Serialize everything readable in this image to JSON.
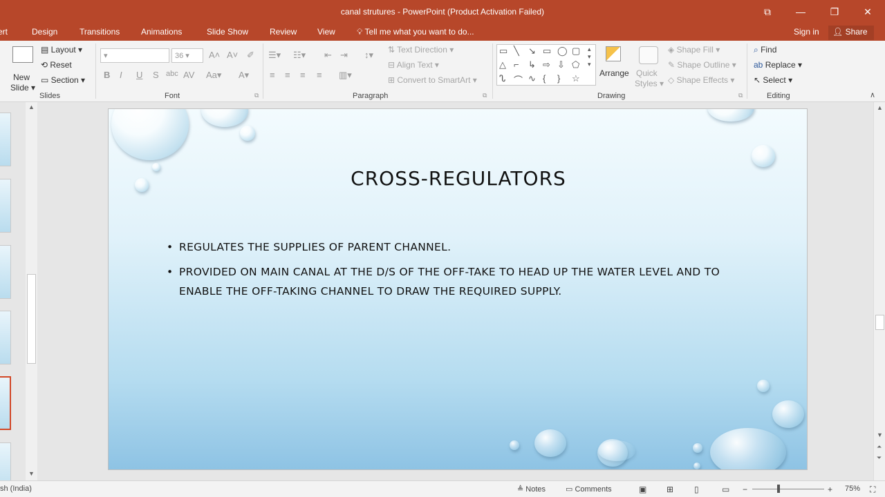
{
  "window": {
    "title": "canal strutures - PowerPoint (Product Activation Failed)",
    "controls": [
      "⧉",
      "—",
      "❐",
      "✕"
    ]
  },
  "tabs": [
    "ert",
    "Design",
    "Transitions",
    "Animations",
    "Slide Show",
    "Review",
    "View"
  ],
  "tell_me": "Tell me what you want to do...",
  "account": {
    "sign_in": "Sign in",
    "share": "Share"
  },
  "ribbon": {
    "slides": {
      "new_slide": "New",
      "new_slide2": "Slide",
      "layout": "Layout",
      "reset": "Reset",
      "section": "Section",
      "label": "Slides"
    },
    "font": {
      "size": "36",
      "label": "Font"
    },
    "paragraph": {
      "text_direction": "Text Direction",
      "align_text": "Align Text",
      "smartart": "Convert to SmartArt",
      "label": "Paragraph"
    },
    "drawing": {
      "arrange": "Arrange",
      "quick": "Quick",
      "styles": "Styles",
      "shape_fill": "Shape Fill",
      "shape_outline": "Shape Outline",
      "shape_effects": "Shape Effects",
      "label": "Drawing"
    },
    "editing": {
      "find": "Find",
      "replace": "Replace",
      "select": "Select",
      "label": "Editing"
    }
  },
  "slide": {
    "title": "CROSS-REGULATORS",
    "bullets": [
      "REGULATES THE SUPPLIES OF PARENT CHANNEL.",
      "PROVIDED ON MAIN CANAL AT THE D/S OF THE OFF-TAKE TO HEAD UP THE WATER LEVEL AND TO ENABLE THE OFF-TAKING CHANNEL TO DRAW THE REQUIRED SUPPLY."
    ]
  },
  "status": {
    "language": "sh (India)",
    "notes": "Notes",
    "comments": "Comments",
    "zoom": "75%"
  },
  "colors": {
    "accent": "#b7472a",
    "active_thumb": "#d24726"
  }
}
